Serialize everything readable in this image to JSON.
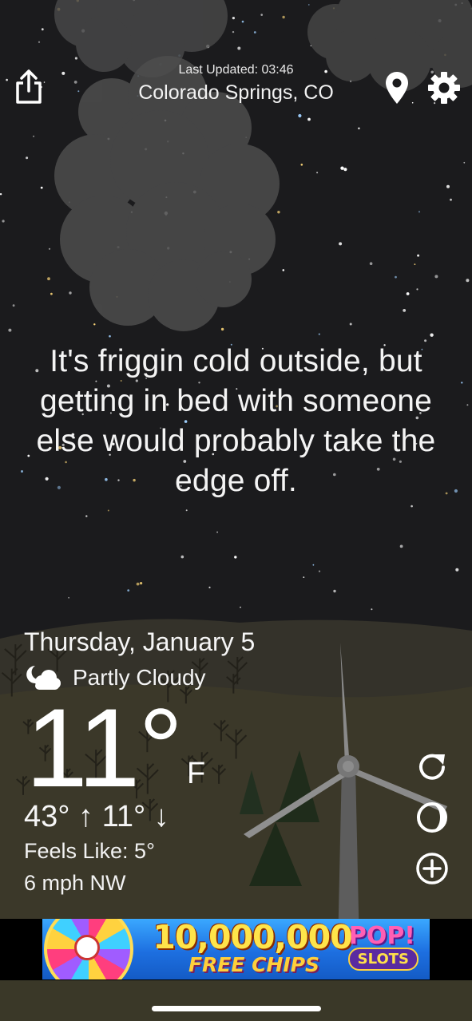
{
  "header": {
    "last_updated": "Last Updated: 03:46",
    "location": "Colorado Springs, CO",
    "icons": [
      "share-icon",
      "location-pin-icon",
      "gear-icon"
    ]
  },
  "quote": "It's friggin cold outside, but getting in bed with someone else would probably take the edge off.",
  "weather": {
    "date": "Thursday, January 5",
    "condition": "Partly Cloudy",
    "condition_icon": "partly-cloudy-night-icon",
    "temperature": "11°",
    "unit": "F",
    "hi_lo": "43° ↑  11° ↓",
    "feels_like": "Feels Like: 5°",
    "wind": "6 mph NW"
  },
  "actions": [
    "refresh-icon",
    "moon-phase-icon",
    "add-icon"
  ],
  "ad": {
    "headline": "10,000,000",
    "subline": "FREE CHIPS",
    "brand": "POP!",
    "brand_sub": "SLOTS"
  },
  "colors": {
    "sky": "#1b1b1d",
    "hill": "#3a3728",
    "ground": "#2b2a24",
    "text": "#ffffff"
  }
}
